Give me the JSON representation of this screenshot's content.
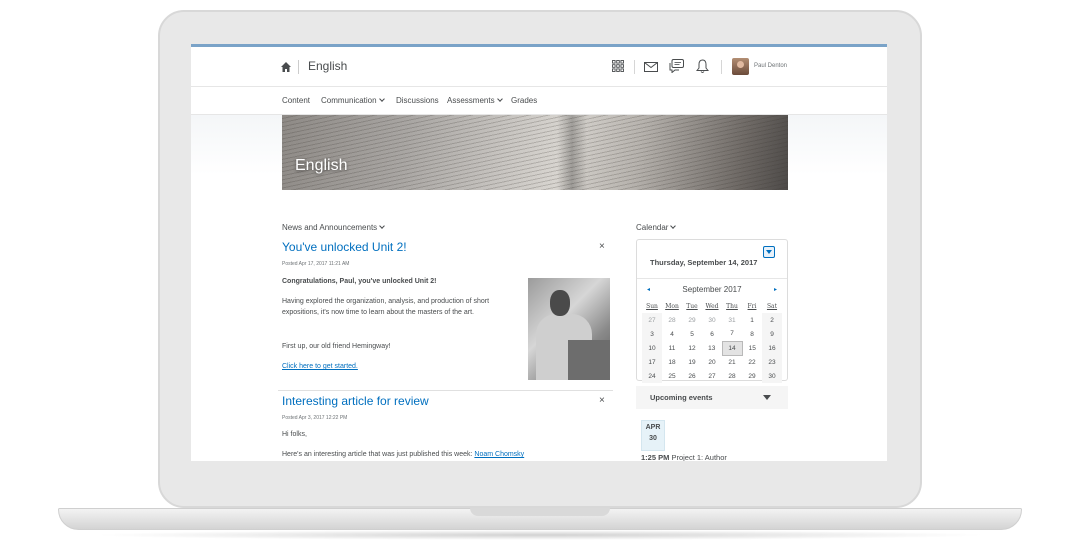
{
  "header": {
    "course_title": "English",
    "user_name": "Paul Denton"
  },
  "nav": {
    "items": [
      {
        "label": "Content",
        "dropdown": false
      },
      {
        "label": "Communication",
        "dropdown": true
      },
      {
        "label": "Discussions",
        "dropdown": false
      },
      {
        "label": "Assessments",
        "dropdown": true
      },
      {
        "label": "Grades",
        "dropdown": false
      }
    ]
  },
  "banner": {
    "title": "English"
  },
  "news": {
    "heading": "News and Announcements",
    "items": [
      {
        "title": "You've unlocked Unit 2!",
        "posted": "Posted Apr 17, 2017 11:21 AM",
        "lead": "Congratulations, Paul, you've unlocked Unit 2!",
        "para1": "Having explored the organization, analysis, and production of short expositions, it's now time to learn about the masters of the art.",
        "para2": "First up, our old friend Hemingway!",
        "link": "Click here to get started."
      },
      {
        "title": "Interesting article for review",
        "posted": "Posted Apr 3, 2017 12:22 PM",
        "para1": "Hi folks,",
        "para2_prefix": "Here's an interesting article that was just published this week: ",
        "link": "Noam Chomsky"
      }
    ]
  },
  "calendar": {
    "heading": "Calendar",
    "selected_date": "Thursday, September 14, 2017",
    "month": "September 2017",
    "prev": "◂",
    "next": "▸",
    "weekdays": [
      "Sun",
      "Mon",
      "Tue",
      "Wed",
      "Thu",
      "Fri",
      "Sat"
    ],
    "weeks": [
      [
        "27",
        "28",
        "29",
        "30",
        "31",
        "1",
        "2"
      ],
      [
        "3",
        "4",
        "5",
        "6",
        "7",
        "8",
        "9"
      ],
      [
        "10",
        "11",
        "12",
        "13",
        "14",
        "15",
        "16"
      ],
      [
        "17",
        "18",
        "19",
        "20",
        "21",
        "22",
        "23"
      ],
      [
        "24",
        "25",
        "26",
        "27",
        "28",
        "29",
        "30"
      ]
    ],
    "today": "14",
    "upcoming_label": "Upcoming events",
    "event": {
      "month": "APR",
      "day": "30",
      "time": "1:25 PM",
      "name": "Project 1: Author"
    }
  },
  "icons": {
    "home": "home-icon",
    "grid": "grid-icon",
    "mail": "mail-icon",
    "chat": "chat-icon",
    "bell": "bell-icon",
    "close": "×"
  },
  "colors": {
    "link": "#006fbf",
    "text": "#494c4e",
    "accent_bar": "#7aa3c8"
  }
}
